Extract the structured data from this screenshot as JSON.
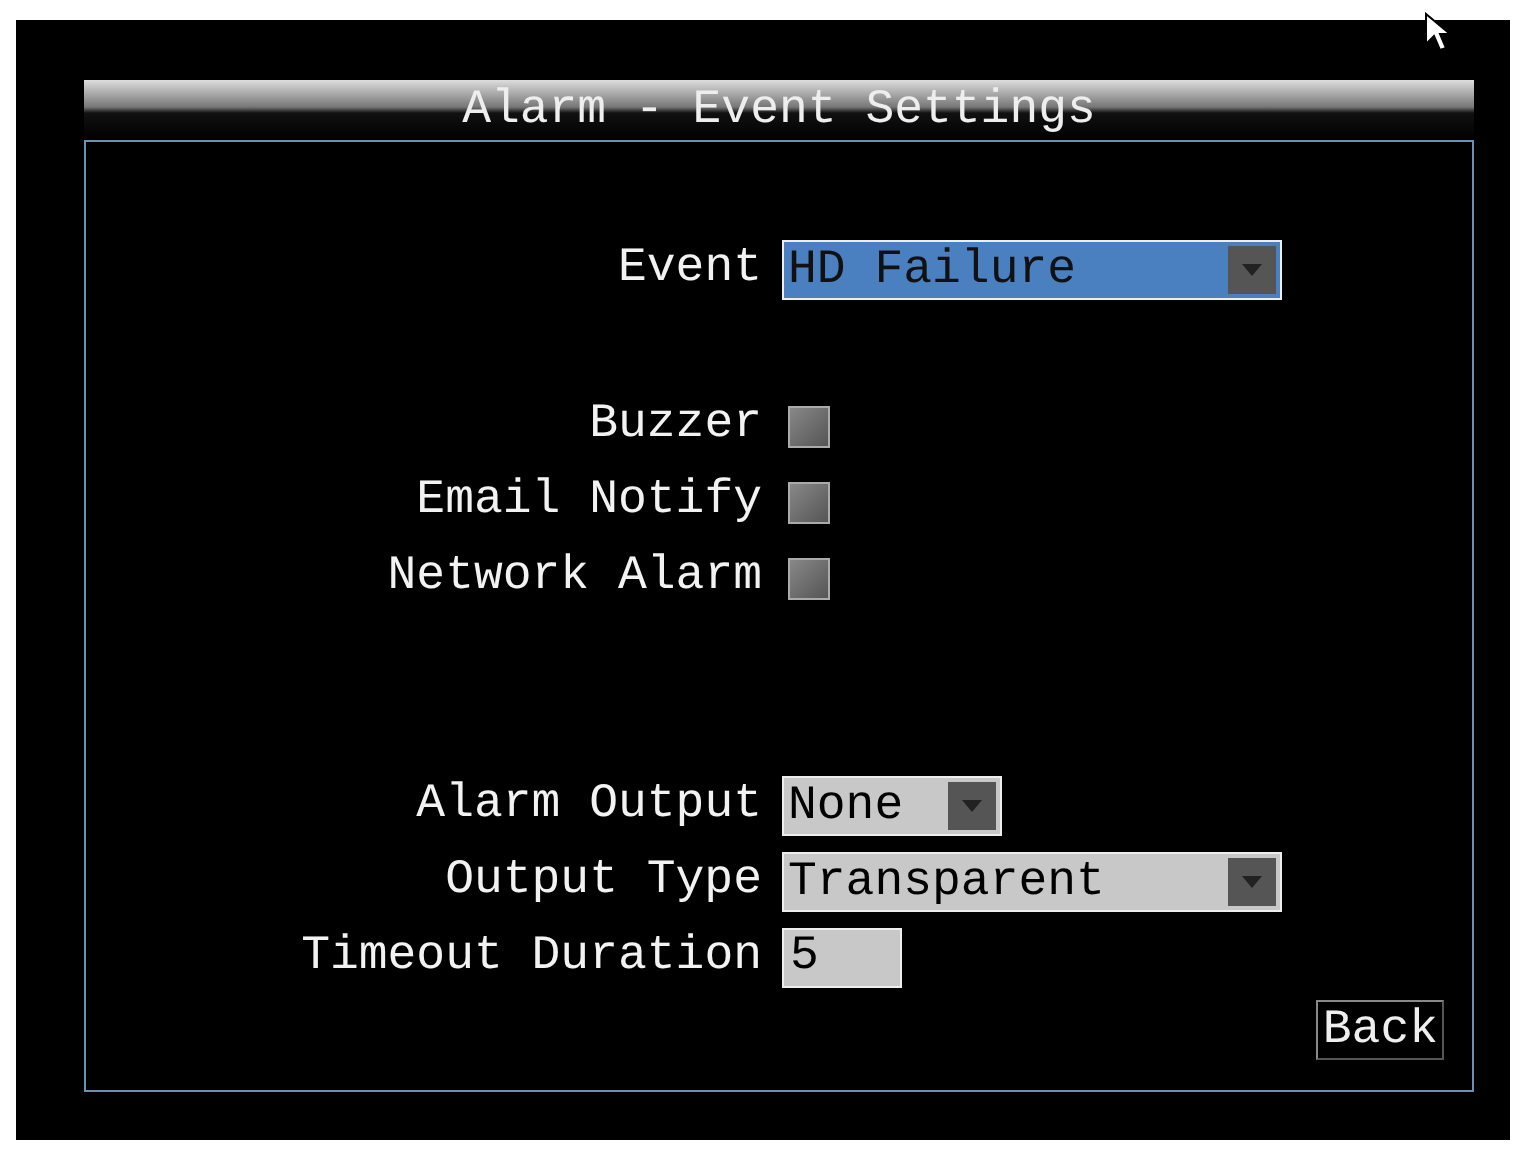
{
  "window": {
    "title": "Alarm - Event Settings"
  },
  "event": {
    "kind": "dropdown",
    "label": "Event",
    "value": "HD Failure",
    "focused": true
  },
  "notifications": [
    {
      "label": "Buzzer",
      "checked": false
    },
    {
      "label": "Email Notify",
      "checked": false
    },
    {
      "label": "Network Alarm",
      "checked": false
    }
  ],
  "outputs": [
    {
      "kind": "dropdown",
      "label": "Alarm Output",
      "value": "None",
      "focused": false
    },
    {
      "kind": "dropdown",
      "label": "Output Type",
      "value": "Transparent",
      "focused": false
    },
    {
      "kind": "textbox",
      "label": "Timeout Duration",
      "value": "5",
      "focused": false
    }
  ],
  "back_button": {
    "label": "Back"
  }
}
